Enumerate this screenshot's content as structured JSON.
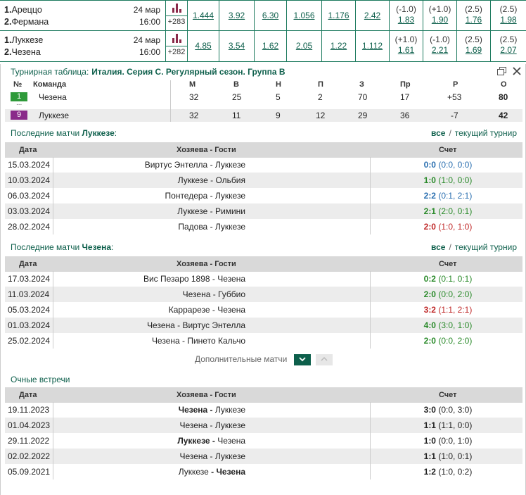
{
  "matches": [
    {
      "team1_num": "1.",
      "team1": "Ареццо",
      "team2_num": "2.",
      "team2": "Фермана",
      "date": "24 мар",
      "time": "16:00",
      "count": "+283",
      "odds": [
        "1.444",
        "3.92",
        "6.30",
        "1.056",
        "1.176",
        "2.42"
      ],
      "h1_hdr": "(-1.0)",
      "h1_val": "1.83",
      "h2_hdr": "(+1.0)",
      "h2_val": "1.90",
      "t1_hdr": "(2.5)",
      "t1_val": "1.76",
      "t2_hdr": "(2.5)",
      "t2_val": "1.98"
    },
    {
      "team1_num": "1.",
      "team1": "Луккезе",
      "team2_num": "2.",
      "team2": "Чезена",
      "date": "24 мар",
      "time": "16:00",
      "count": "+282",
      "odds": [
        "4.85",
        "3.54",
        "1.62",
        "2.05",
        "1.22",
        "1.112"
      ],
      "h1_hdr": "(+1.0)",
      "h1_val": "1.61",
      "h2_hdr": "(-1.0)",
      "h2_val": "2.21",
      "t1_hdr": "(2.5)",
      "t1_val": "1.69",
      "t2_hdr": "(2.5)",
      "t2_val": "2.07"
    }
  ],
  "standings": {
    "label": "Турнирная таблица:",
    "league": "Италия. Серия С. Регулярный сезон. Группа B",
    "columns": [
      "№",
      "Команда",
      "М",
      "В",
      "Н",
      "П",
      "З",
      "Пр",
      "Р",
      "О"
    ],
    "ellipsis": "...",
    "rows": [
      {
        "pos": "1",
        "team": "Чезена",
        "m": "32",
        "w": "25",
        "d": "5",
        "l": "2",
        "gf": "70",
        "ga": "17",
        "diff": "+53",
        "pts": "80",
        "color": "#2e9a3a"
      },
      {
        "pos": "9",
        "team": "Луккезе",
        "m": "32",
        "w": "11",
        "d": "9",
        "l": "12",
        "gf": "29",
        "ga": "36",
        "diff": "-7",
        "pts": "42",
        "color": "#8a2a8a"
      }
    ]
  },
  "links": {
    "all": "все",
    "sep": "/",
    "current": "текущий турнир"
  },
  "headers": {
    "date": "Дата",
    "match": "Хозяева - Гости",
    "score": "Счет"
  },
  "lucchese_last": {
    "title_prefix": "Последние матчи ",
    "team": "Луккезе",
    "title_suffix": ":",
    "rows": [
      {
        "date": "15.03.2024",
        "match": "Виртус Энтелла - Луккезе",
        "score": "0:0",
        "ht": "(0:0, 0:0)",
        "res": "draw"
      },
      {
        "date": "10.03.2024",
        "match": "Луккезе - Ольбия",
        "score": "1:0",
        "ht": "(1:0, 0:0)",
        "res": "win"
      },
      {
        "date": "06.03.2024",
        "match": "Понтедера - Луккезе",
        "score": "2:2",
        "ht": "(0:1, 2:1)",
        "res": "draw"
      },
      {
        "date": "03.03.2024",
        "match": "Луккезе - Римини",
        "score": "2:1",
        "ht": "(2:0, 0:1)",
        "res": "win"
      },
      {
        "date": "28.02.2024",
        "match": "Падова - Луккезе",
        "score": "2:0",
        "ht": "(1:0, 1:0)",
        "res": "loss"
      }
    ]
  },
  "cesena_last": {
    "title_prefix": "Последние матчи ",
    "team": "Чезена",
    "title_suffix": ":",
    "rows": [
      {
        "date": "17.03.2024",
        "match": "Вис Пезаро 1898 - Чезена",
        "score": "0:2",
        "ht": "(0:1, 0:1)",
        "res": "win"
      },
      {
        "date": "11.03.2024",
        "match": "Чезена - Губбио",
        "score": "2:0",
        "ht": "(0:0, 2:0)",
        "res": "win"
      },
      {
        "date": "05.03.2024",
        "match": "Каррарезе - Чезена",
        "score": "3:2",
        "ht": "(1:1, 2:1)",
        "res": "loss"
      },
      {
        "date": "01.03.2024",
        "match": "Чезена - Виртус Энтелла",
        "score": "4:0",
        "ht": "(3:0, 1:0)",
        "res": "win"
      },
      {
        "date": "25.02.2024",
        "match": "Чезена - Пинето Кальчо",
        "score": "2:0",
        "ht": "(0:0, 2:0)",
        "res": "win"
      }
    ]
  },
  "more_label": "Дополнительные матчи",
  "h2h": {
    "title": "Очные встречи",
    "rows": [
      {
        "date": "19.11.2023",
        "home": "Чезена",
        "away": "Луккезе",
        "bold": "home",
        "score": "3:0",
        "ht": "(0:0, 3:0)"
      },
      {
        "date": "01.04.2023",
        "home": "Чезена",
        "away": "Луккезе",
        "bold": "none",
        "score": "1:1",
        "ht": "(1:1, 0:0)"
      },
      {
        "date": "29.11.2022",
        "home": "Луккезе",
        "away": "Чезена",
        "bold": "home",
        "score": "1:0",
        "ht": "(0:0, 1:0)"
      },
      {
        "date": "02.02.2022",
        "home": "Чезена",
        "away": "Луккезе",
        "bold": "none",
        "score": "1:1",
        "ht": "(1:0, 0:1)"
      },
      {
        "date": "05.09.2021",
        "home": "Луккезе",
        "away": "Чезена",
        "bold": "away",
        "score": "1:2",
        "ht": "(1:0, 0:2)"
      }
    ]
  },
  "dash": " - ",
  "colors": {
    "accent": "#0d5f4b",
    "border": "#1c7a5e",
    "win": "#2a8a2a",
    "draw": "#2a6fb0",
    "loss": "#c02a2a"
  },
  "icons": {
    "stats": "bar-chart-icon",
    "restore": "restore-window-icon",
    "close": "close-icon",
    "down": "chevron-down-icon",
    "up": "chevron-up-icon"
  }
}
